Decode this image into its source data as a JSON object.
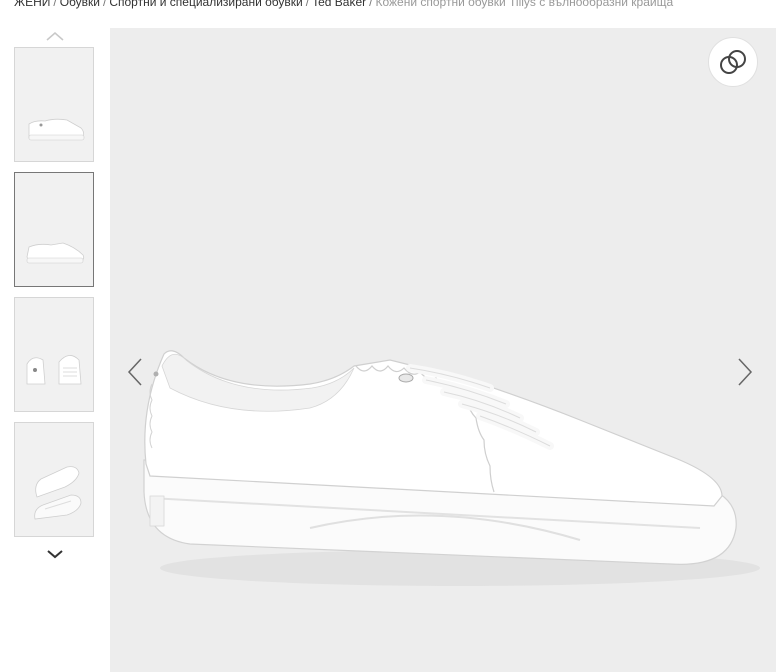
{
  "breadcrumb": {
    "items": [
      "ЖЕНИ",
      "Обувки",
      "Спортни и специализирани обувки",
      "Ted Baker"
    ],
    "separator": "/",
    "current": "Кожени спортни обувки Tillys с вълнообразни краища"
  },
  "gallery": {
    "thumbnails": [
      {
        "view": "side"
      },
      {
        "view": "side-angle",
        "active": true
      },
      {
        "view": "front-back"
      },
      {
        "view": "top-sole"
      }
    ],
    "up_icon": "chevron-up-icon",
    "down_icon": "chevron-down-icon"
  },
  "viewer": {
    "zoom_icon": "zoom-rings-icon",
    "prev_icon": "chevron-left-icon",
    "next_icon": "chevron-right-icon"
  },
  "colors": {
    "image_bg": "#ededed",
    "thumb_border_active": "#777777"
  }
}
